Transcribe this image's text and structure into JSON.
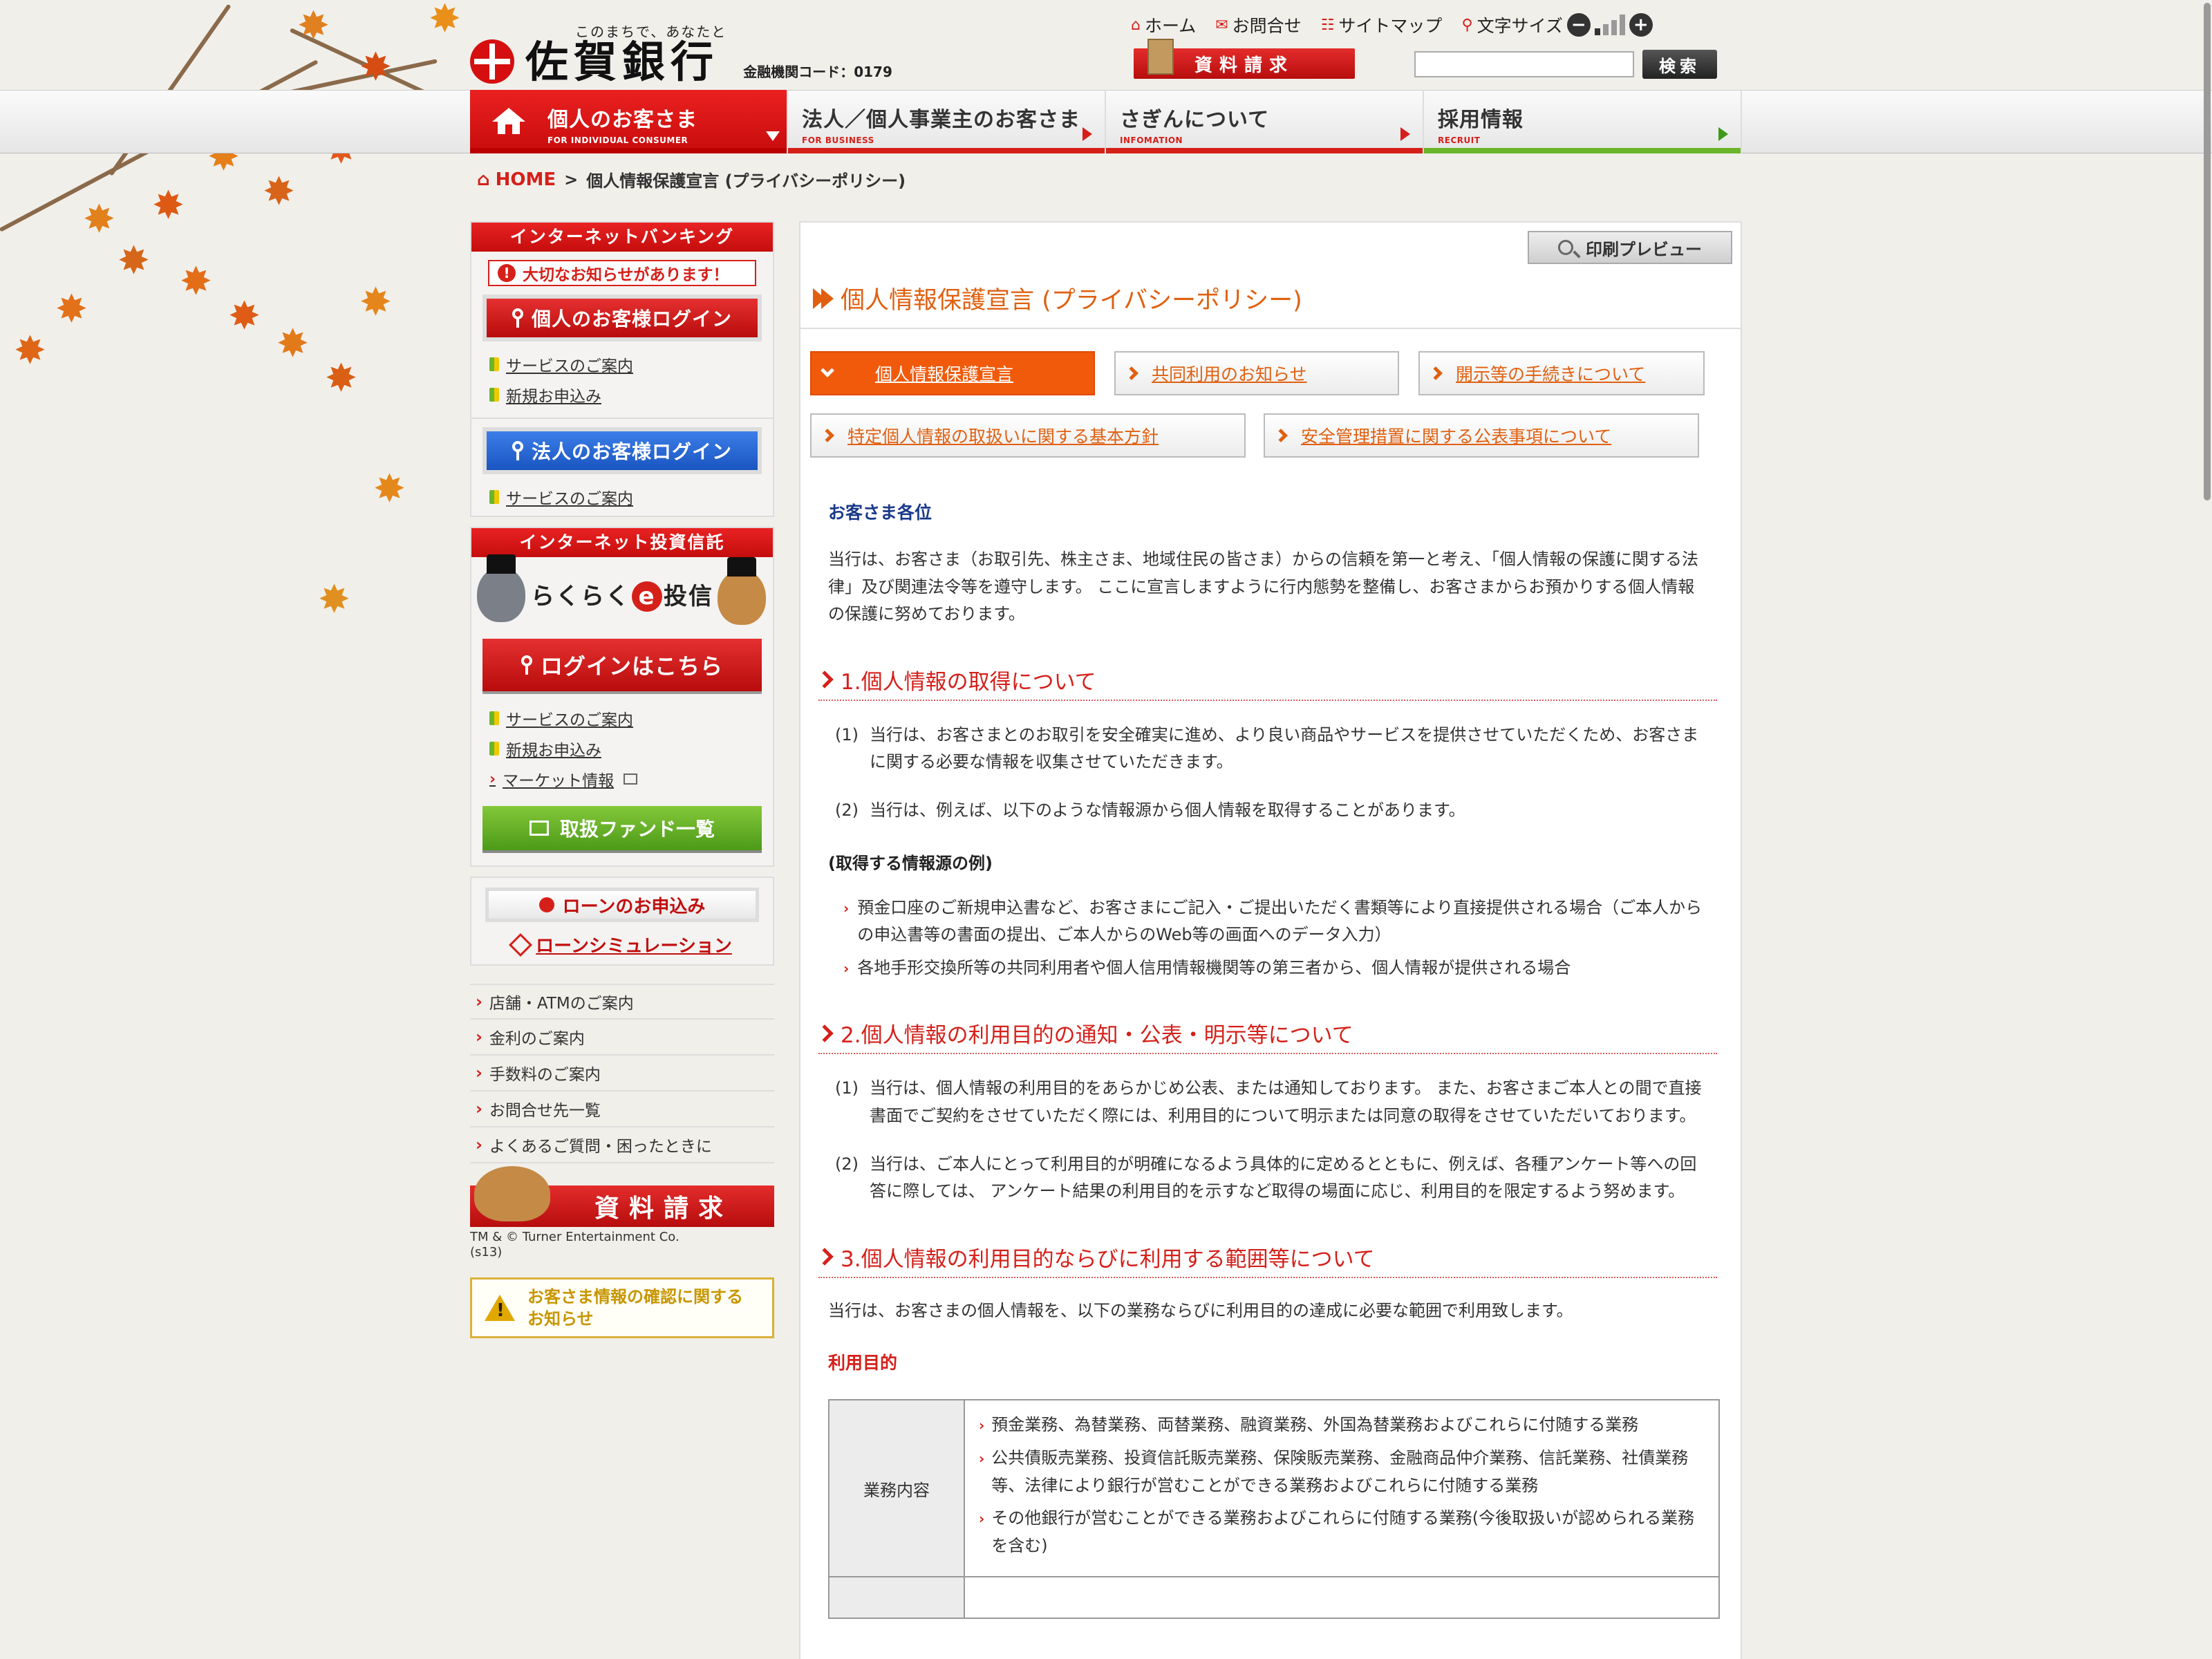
{
  "header": {
    "tagline": "このまちで、あなたと",
    "bank_name": "佐賀銀行",
    "bank_code": "金融機関コード：0179",
    "util_links": [
      "ホーム",
      "お問合せ",
      "サイトマップ",
      "文字サイズ"
    ],
    "request_button": "資料請求",
    "search_button": "検索",
    "search_placeholder": ""
  },
  "global_nav": [
    {
      "title": "個人のお客さま",
      "sub": "FOR INDIVIDUAL CONSUMER"
    },
    {
      "title": "法人／個人事業主のお客さま",
      "sub": "FOR BUSINESS"
    },
    {
      "title": "さぎんについて",
      "sub": "INFOMATION"
    },
    {
      "title": "採用情報",
      "sub": "RECRUIT"
    }
  ],
  "breadcrumb": {
    "home": "HOME",
    "sep": ">",
    "current": "個人情報保護宣言 (プライバシーポリシー)"
  },
  "sidebar": {
    "ib_head": "インターネットバンキング",
    "notice": "大切なお知らせがあります！",
    "personal_login": "個人のお客様ログイン",
    "service_guide": "サービスのご案内",
    "new_apply": "新規お申込み",
    "corp_login": "法人のお客様ログイン",
    "corp_service": "サービスのご案内",
    "trust_head": "インターネット投資信託",
    "rakuraku_pre": "らくらく",
    "rakuraku_e": "e",
    "rakuraku_post": "投信",
    "login_here": "ログインはこちら",
    "trust_service": "サービスのご案内",
    "trust_new": "新規お申込み",
    "market": "マーケット情報",
    "fund_list": "取扱ファンド一覧",
    "loan_apply": "ローンのお申込み",
    "loan_sim": "ローンシミュレーション",
    "links": [
      "店舗・ATMのご案内",
      "金利のご案内",
      "手数料のご案内",
      "お問合せ先一覧",
      "よくあるご質問・困ったときに"
    ],
    "material_banner": "資料請求",
    "tm_line1": "TM & © Turner Entertainment Co.",
    "tm_line2": "(s13)",
    "warn_line1": "お客さま情報の確認に関する",
    "warn_line2": "お知らせ"
  },
  "main": {
    "print_preview": "印刷プレビュー",
    "title": "個人情報保護宣言 (プライバシーポリシー)",
    "tabs": [
      "個人情報保護宣言",
      "共同利用のお知らせ",
      "開示等の手続きについて",
      "特定個人情報の取扱いに関する基本方針",
      "安全管理措置に関する公表事項について"
    ],
    "salutation": "お客さま各位",
    "intro": "当行は、お客さま（お取引先、株主さま、地域住民の皆さま）からの信頼を第一と考え、「個人情報の保護に関する法律」及び関連法令等を遵守します。 ここに宣言しますように行内態勢を整備し、お客さまからお預かりする個人情報の保護に努めております。",
    "s1_title": "1.個人情報の取得について",
    "s1_items": [
      {
        "num": "(1)",
        "text": "当行は、お客さまとのお取引を安全確実に進め、より良い商品やサービスを提供させていただくため、お客さまに関する必要な情報を収集させていただきます。"
      },
      {
        "num": "(2)",
        "text": "当行は、例えば、以下のような情報源から個人情報を取得することがあります。"
      }
    ],
    "s1_subhead": "(取得する情報源の例)",
    "s1_sub": [
      "預金口座のご新規申込書など、お客さまにご記入・ご提出いただく書類等により直接提供される場合（ご本人からの申込書等の書面の提出、ご本人からのWeb等の画面へのデータ入力）",
      "各地手形交換所等の共同利用者や個人信用情報機関等の第三者から、個人情報が提供される場合"
    ],
    "s2_title": "2.個人情報の利用目的の通知・公表・明示等について",
    "s2_items": [
      {
        "num": "(1)",
        "text": "当行は、個人情報の利用目的をあらかじめ公表、または通知しております。 また、お客さまご本人との間で直接書面でご契約をさせていただく際には、利用目的について明示または同意の取得をさせていただいております。"
      },
      {
        "num": "(2)",
        "text": "当行は、ご本人にとって利用目的が明確になるよう具体的に定めるとともに、例えば、各種アンケート等への回答に際しては、 アンケート結果の利用目的を示すなど取得の場面に応じ、利用目的を限定するよう努めます。"
      }
    ],
    "s3_title": "3.個人情報の利用目的ならびに利用する範囲等について",
    "s3_intro": "当行は、お客さまの個人情報を、以下の業務ならびに利用目的の達成に必要な範囲で利用致します。",
    "purpose_label": "利用目的",
    "table_header": "業務内容",
    "table_items": [
      "預金業務、為替業務、両替業務、融資業務、外国為替業務およびこれらに付随する業務",
      "公共債販売業務、投資信託販売業務、保険販売業務、金融商品仲介業務、信託業務、社債業務等、法律により銀行が営むことができる業務およびこれらに付随する業務",
      "その他銀行が営むことができる業務およびこれらに付随する業務(今後取扱いが認められる業務を含む)"
    ]
  },
  "colors": {
    "brand_red": "#d5201a",
    "accent_orange": "#e06010",
    "recruit_green": "#6ab52a"
  }
}
